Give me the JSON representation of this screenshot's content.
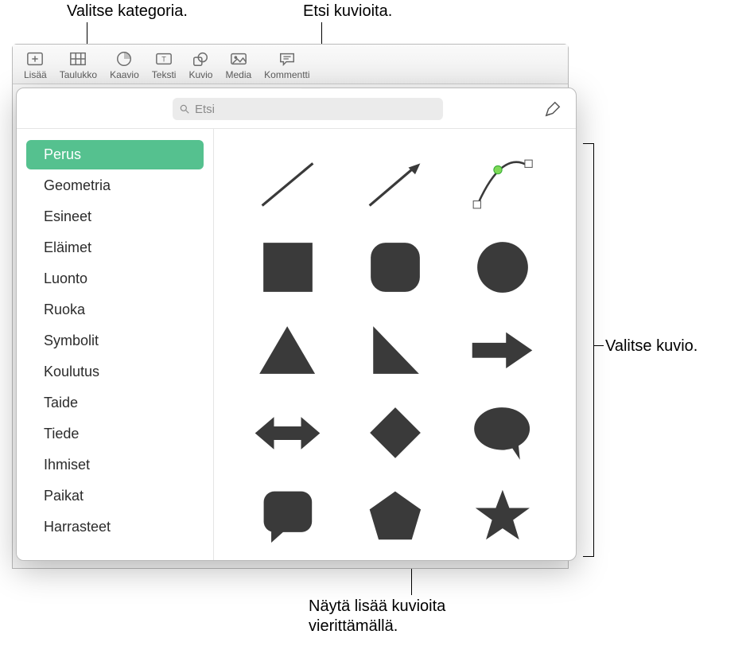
{
  "callouts": {
    "category": "Valitse kategoria.",
    "search": "Etsi kuvioita.",
    "select_shape": "Valitse kuvio.",
    "scroll_more": "Näytä lisää kuvioita\nvierittämällä."
  },
  "toolbar": {
    "items": [
      {
        "label": "Lisää",
        "name": "add"
      },
      {
        "label": "Taulukko",
        "name": "table"
      },
      {
        "label": "Kaavio",
        "name": "chart"
      },
      {
        "label": "Teksti",
        "name": "text"
      },
      {
        "label": "Kuvio",
        "name": "shape"
      },
      {
        "label": "Media",
        "name": "media"
      },
      {
        "label": "Kommentti",
        "name": "comment"
      }
    ]
  },
  "search": {
    "placeholder": "Etsi"
  },
  "sidebar": {
    "items": [
      {
        "label": "Perus",
        "selected": true
      },
      {
        "label": "Geometria",
        "selected": false
      },
      {
        "label": "Esineet",
        "selected": false
      },
      {
        "label": "Eläimet",
        "selected": false
      },
      {
        "label": "Luonto",
        "selected": false
      },
      {
        "label": "Ruoka",
        "selected": false
      },
      {
        "label": "Symbolit",
        "selected": false
      },
      {
        "label": "Koulutus",
        "selected": false
      },
      {
        "label": "Taide",
        "selected": false
      },
      {
        "label": "Tiede",
        "selected": false
      },
      {
        "label": "Ihmiset",
        "selected": false
      },
      {
        "label": "Paikat",
        "selected": false
      },
      {
        "label": "Harrasteet",
        "selected": false
      }
    ]
  },
  "shapes": [
    {
      "name": "line"
    },
    {
      "name": "arrow-line"
    },
    {
      "name": "bezier-curve"
    },
    {
      "name": "square"
    },
    {
      "name": "rounded-square"
    },
    {
      "name": "circle"
    },
    {
      "name": "triangle"
    },
    {
      "name": "right-triangle"
    },
    {
      "name": "arrow-right"
    },
    {
      "name": "double-arrow"
    },
    {
      "name": "diamond"
    },
    {
      "name": "speech-bubble"
    },
    {
      "name": "rounded-speech-square"
    },
    {
      "name": "pentagon"
    },
    {
      "name": "star"
    }
  ]
}
